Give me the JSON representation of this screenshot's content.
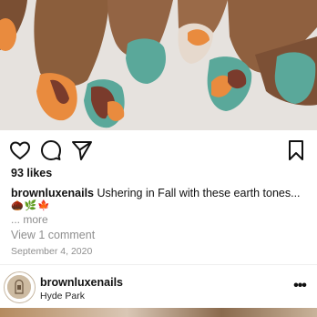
{
  "post": {
    "image_alt": "Fall nail art photo",
    "likes": "93 likes",
    "caption_user": "brownluxenails",
    "caption_text": "Ushering in Fall with these earth tones...",
    "emojis": "🌰🌿🍁",
    "more_label": "... more",
    "view_comments": "View 1 comment",
    "date": "September 4, 2020"
  },
  "icons": {
    "like": "heart-icon",
    "comment": "comment-icon",
    "share": "paper-plane-icon",
    "save": "bookmark-icon",
    "menu": "more-options-icon"
  },
  "next_post": {
    "username": "brownluxenails",
    "location": "Hyde Park",
    "menu_glyph": "•••"
  },
  "colors": {
    "teal": "#5aa89a",
    "orange": "#e98b3e",
    "brown": "#7a3b2c",
    "skin": "#8b5e3c",
    "muted_text": "#8e8e8e"
  }
}
